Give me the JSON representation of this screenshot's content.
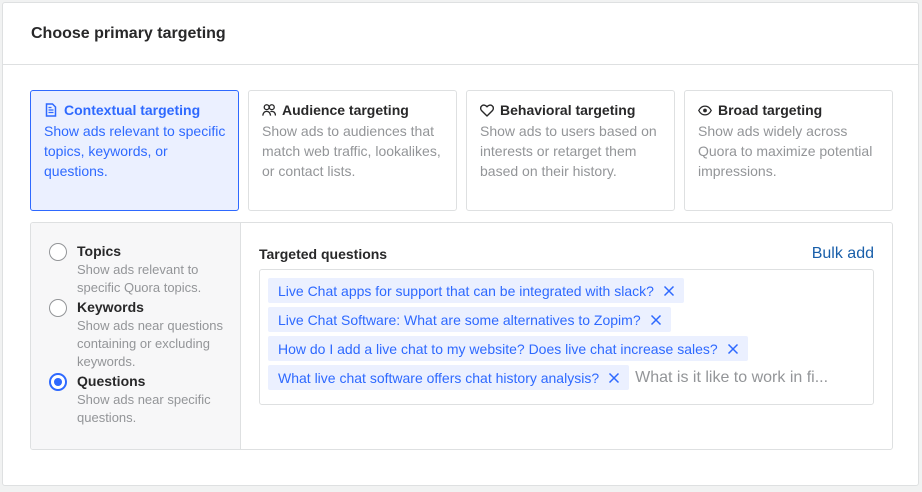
{
  "header": {
    "title": "Choose primary targeting"
  },
  "cards": [
    {
      "title": "Contextual targeting",
      "desc": "Show ads relevant to specific topics, keywords, or questions.",
      "icon": "document-icon"
    },
    {
      "title": "Audience targeting",
      "desc": "Show ads to audiences that match web traffic, lookalikes, or contact lists.",
      "icon": "people-icon"
    },
    {
      "title": "Behavioral targeting",
      "desc": "Show ads to users based on interests or retarget them based on their history.",
      "icon": "heart-icon"
    },
    {
      "title": "Broad targeting",
      "desc": "Show ads widely across Quora to maximize potential impressions.",
      "icon": "eye-icon"
    }
  ],
  "options": [
    {
      "label": "Topics",
      "desc": "Show ads relevant to specific Quora topics.",
      "selected": false
    },
    {
      "label": "Keywords",
      "desc": "Show ads near questions containing or excluding keywords.",
      "selected": false
    },
    {
      "label": "Questions",
      "desc": "Show ads near specific questions.",
      "selected": true
    }
  ],
  "questions": {
    "title": "Targeted questions",
    "bulk_add": "Bulk add",
    "tags": [
      "Live Chat apps for support that can be integrated with slack?",
      "Live Chat Software: What are some alternatives to Zopim?",
      "How do I add a live chat to my website? Does live chat increase sales?",
      "What live chat software offers chat history analysis?"
    ],
    "input_placeholder": "What is it like to work in fi..."
  },
  "colors": {
    "accent": "#2e69ff",
    "accent_bg": "#ebf0ff",
    "link": "#195faa",
    "muted": "#939598",
    "border": "#dee0e1"
  }
}
